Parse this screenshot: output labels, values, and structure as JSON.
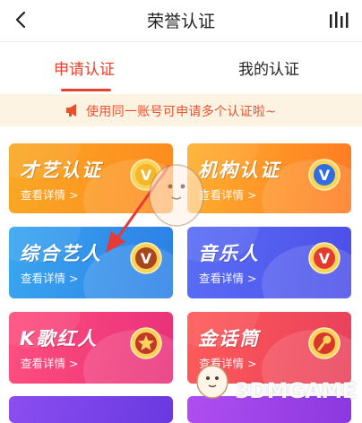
{
  "header": {
    "title": "荣誉认证",
    "back_icon": "chevron-left-icon",
    "right_icon": "bar-chart-icon"
  },
  "tabs": [
    {
      "label": "申请认证",
      "active": true
    },
    {
      "label": "我的认证",
      "active": false
    }
  ],
  "notice": {
    "icon": "megaphone-icon",
    "text": "使用同一账号可申请多个认证啦~"
  },
  "cards": [
    {
      "name": "才艺认证",
      "detail": "查看详情 >",
      "badge": "V",
      "color": "#ff9a1f"
    },
    {
      "name": "机构认证",
      "detail": "查看详情 >",
      "badge": "V",
      "color": "#ff8a20"
    },
    {
      "name": "综合艺人",
      "detail": "查看详情 >",
      "badge": "V",
      "color": "#3a93ec"
    },
    {
      "name": "音乐人",
      "detail": "查看详情 >",
      "badge": "V",
      "color": "#5160f0"
    },
    {
      "name": "K歌红人",
      "detail": "查看详情 >",
      "badge": "star",
      "color": "#f2417c"
    },
    {
      "name": "金话筒",
      "detail": "查看详情 >",
      "badge": "mic",
      "color": "#f24a5a"
    }
  ],
  "watermark": {
    "text": "3DMGAME"
  },
  "colors": {
    "accent": "#e8412e",
    "notice_bg": "#fdf3e3"
  }
}
